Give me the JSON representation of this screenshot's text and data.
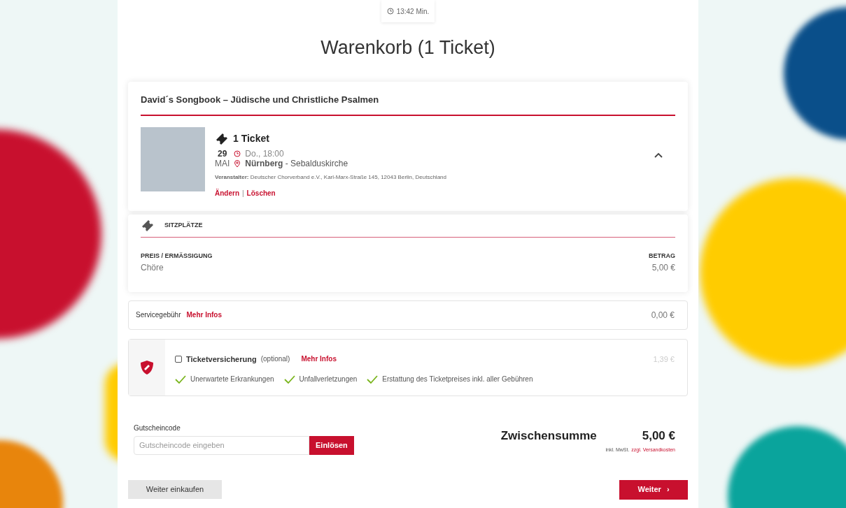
{
  "timer": "13:42 Min.",
  "title": "Warenkorb (1 Ticket)",
  "event": {
    "title": "David´s Songbook – Jüdische und Christliche Psalmen",
    "ticket_count": "1 Ticket",
    "day": "29",
    "month": "MAI",
    "time": "Do., 18:00",
    "venue": "**Nürnberg** - Sebalduskirche",
    "organizer": "**Veranstalter:** Deutscher Chorverband e.V., Karl-Marx-Straße 145, 12043 Berlin, Deutschland",
    "edit_link": "Ändern",
    "separator": "|",
    "delete_link": "Löschen",
    "expanded": true
  },
  "seats": {
    "heading": "SITZPLÄTZE",
    "price_heading": "PREIS / ERMÄSSIGUNG",
    "amount_heading": "BETRAG",
    "rows": [
      {
        "name": "Chöre",
        "amount": "5,00 €"
      }
    ]
  },
  "service_fee": {
    "label": "Servicegebühr",
    "link": "Mehr Infos",
    "amount": "0,00 €"
  },
  "insurance": {
    "checked": false,
    "label": "Ticketversicherung",
    "note": "(optional)",
    "link": "Mehr Infos",
    "price": "1,39 €",
    "benefits": [
      "Unerwartete Erkrankungen",
      "Unfallverletzungen",
      "Erstattung des Ticketpreises inkl. aller Gebühren"
    ]
  },
  "voucher": {
    "label": "Gutscheincode",
    "placeholder": "Gutscheincode eingeben",
    "button": "Einlösen"
  },
  "subtotal": {
    "label": "Zwischensumme",
    "amount": "5,00 €",
    "tax_note": "inkl. MwSt.",
    "shipping_link": "zzgl. Versandkosten"
  },
  "buttons": {
    "back": "Weiter einkaufen",
    "next": "Weiter",
    "next_icon": "›"
  }
}
